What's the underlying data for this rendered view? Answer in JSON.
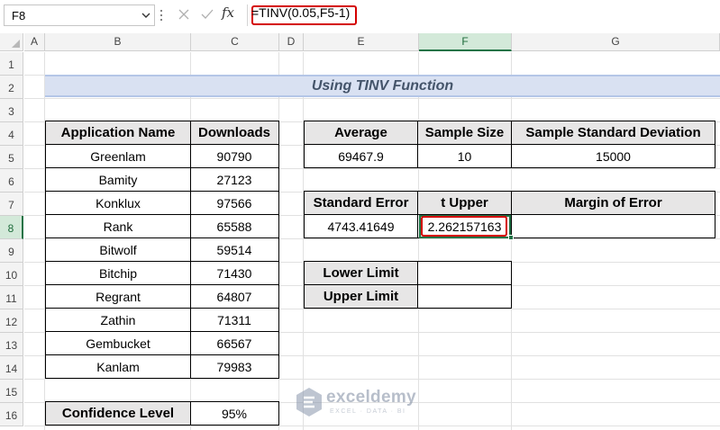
{
  "formula_bar": {
    "name_box": "F8",
    "fx_label": "fx",
    "formula": "=TINV(0.05,F5-1)"
  },
  "columns": [
    "A",
    "B",
    "C",
    "D",
    "E",
    "F",
    "G"
  ],
  "rows": [
    "1",
    "2",
    "3",
    "4",
    "5",
    "6",
    "7",
    "8",
    "9",
    "10",
    "11",
    "12",
    "13",
    "14",
    "15",
    "16"
  ],
  "selected_cell": {
    "column": "F",
    "row": "8"
  },
  "sheet": {
    "title": "Using TINV Function",
    "apps_table": {
      "headers": [
        "Application Name",
        "Downloads"
      ],
      "rows": [
        [
          "Greenlam",
          "90790"
        ],
        [
          "Bamity",
          "27123"
        ],
        [
          "Konklux",
          "97566"
        ],
        [
          "Rank",
          "65588"
        ],
        [
          "Bitwolf",
          "59514"
        ],
        [
          "Bitchip",
          "71430"
        ],
        [
          "Regrant",
          "64807"
        ],
        [
          "Zathin",
          "71311"
        ],
        [
          "Gembucket",
          "66567"
        ],
        [
          "Kanlam",
          "79983"
        ]
      ]
    },
    "confidence": {
      "label": "Confidence Level",
      "value": "95%"
    },
    "stats_table": {
      "headers": [
        "Average",
        "Sample Size",
        "Sample Standard Deviation"
      ],
      "values": [
        "69467.9",
        "10",
        "15000"
      ]
    },
    "error_table": {
      "headers": [
        "Standard Error",
        "t Upper",
        "Margin of Error"
      ],
      "values": [
        "4743.41649",
        "2.262157163",
        ""
      ]
    },
    "limits_table": {
      "rows": [
        {
          "label": "Lower Limit",
          "value": ""
        },
        {
          "label": "Upper Limit",
          "value": ""
        }
      ]
    }
  },
  "watermark": {
    "name": "exceldemy",
    "tagline": "EXCEL · DATA · BI"
  },
  "colors": {
    "header_fill": "#e7e6e6",
    "title_band": "#d9e1f2",
    "title_text": "#44546a",
    "selection_green": "#217346",
    "highlight_red": "#d40000"
  }
}
